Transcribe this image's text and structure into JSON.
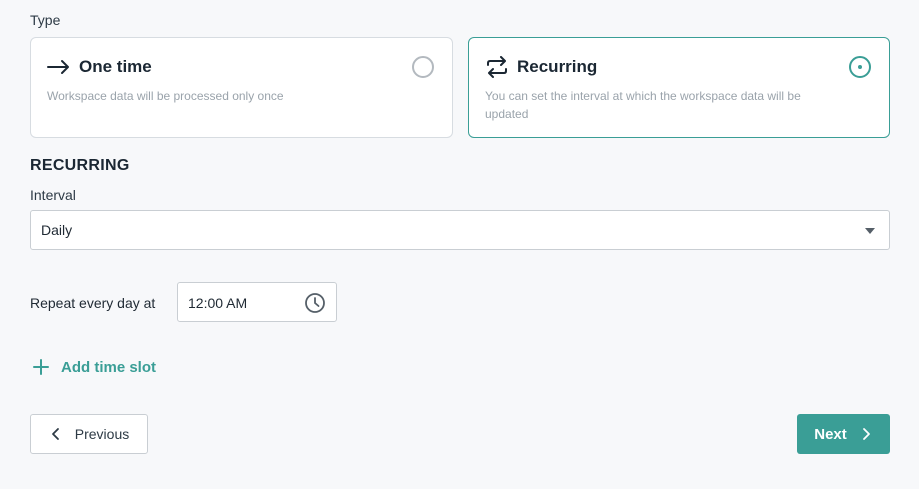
{
  "type_section": {
    "label": "Type",
    "options": [
      {
        "title": "One time",
        "description": "Workspace data will be processed only once",
        "icon": "arrow-right-icon",
        "selected": false
      },
      {
        "title": "Recurring",
        "description": "You can set the interval at which the workspace data will be updated",
        "icon": "repeat-icon",
        "selected": true
      }
    ]
  },
  "recurring": {
    "title": "RECURRING",
    "interval_label": "Interval",
    "interval_value": "Daily",
    "repeat_label": "Repeat every day at",
    "time_value": "12:00 AM",
    "add_slot_label": "Add time slot"
  },
  "nav": {
    "previous_label": "Previous",
    "next_label": "Next"
  },
  "colors": {
    "accent": "#3a9e96",
    "border": "#c9ced3",
    "background": "#f7f8fa"
  }
}
